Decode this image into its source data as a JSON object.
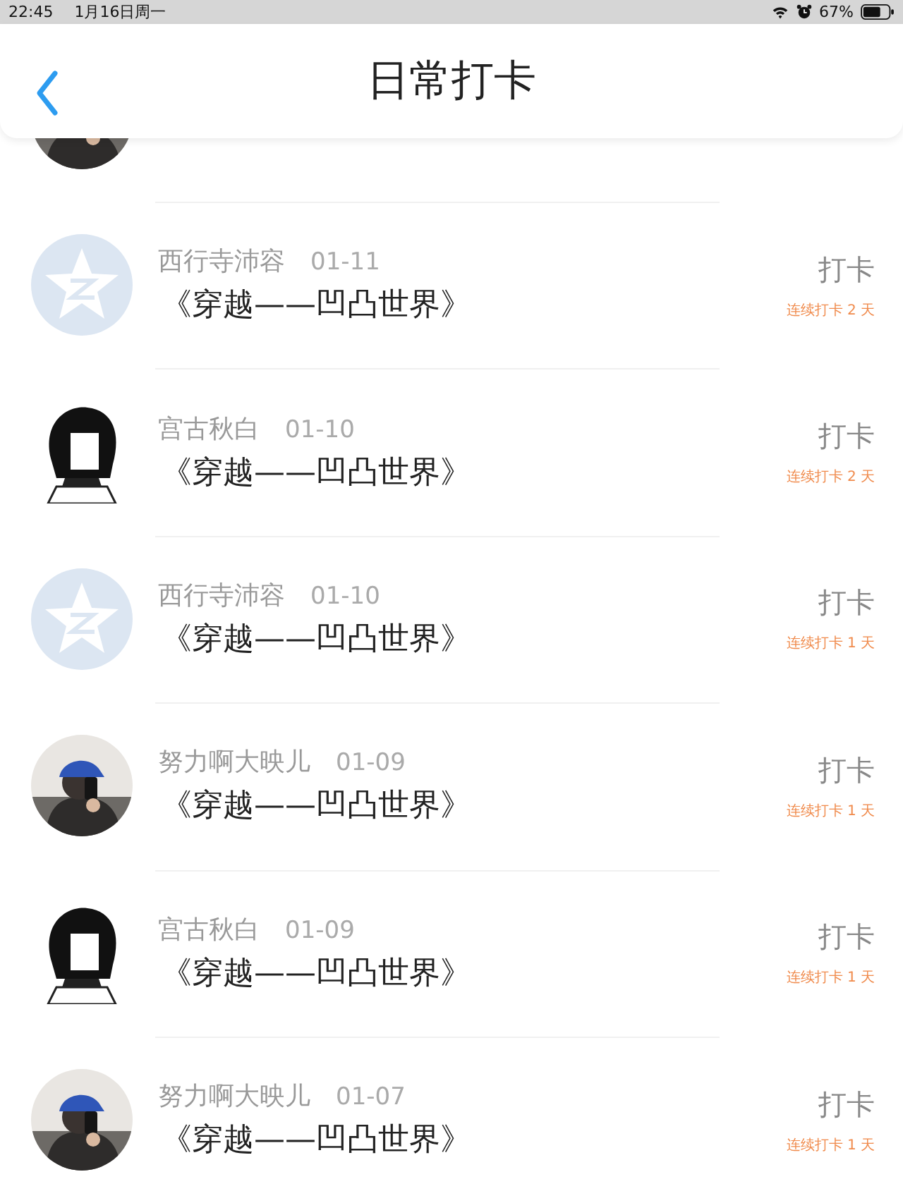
{
  "status_bar": {
    "time": "22:45",
    "date": "1月16日周一",
    "battery": "67%"
  },
  "header": {
    "title": "日常打卡"
  },
  "rows": [
    {
      "avatar": {
        "kind": "star"
      },
      "name": "西行寺沛容",
      "date": "01-11",
      "title": "《穿越——凹凸世界》",
      "action": "打卡",
      "streak": "连续打卡 2 天"
    },
    {
      "avatar": {
        "kind": "girl"
      },
      "name": "宫古秋白",
      "date": "01-10",
      "title": "《穿越——凹凸世界》",
      "action": "打卡",
      "streak": "连续打卡 2 天"
    },
    {
      "avatar": {
        "kind": "star"
      },
      "name": "西行寺沛容",
      "date": "01-10",
      "title": "《穿越——凹凸世界》",
      "action": "打卡",
      "streak": "连续打卡 1 天"
    },
    {
      "name": "努力啊大映儿",
      "date": "01-09",
      "title": "《穿越——凹凸世界》",
      "action": "打卡",
      "streak": "连续打卡 1 天"
    },
    {
      "avatar": {
        "kind": "girl"
      },
      "name": "宫古秋白",
      "date": "01-09",
      "title": "《穿越——凹凸世界》",
      "action": "打卡",
      "streak": "连续打卡 1 天"
    },
    {
      "name": "努力啊大映儿",
      "date": "01-07",
      "title": "《穿越——凹凸世界》",
      "action": "打卡",
      "streak": "连续打卡 1 天"
    }
  ]
}
